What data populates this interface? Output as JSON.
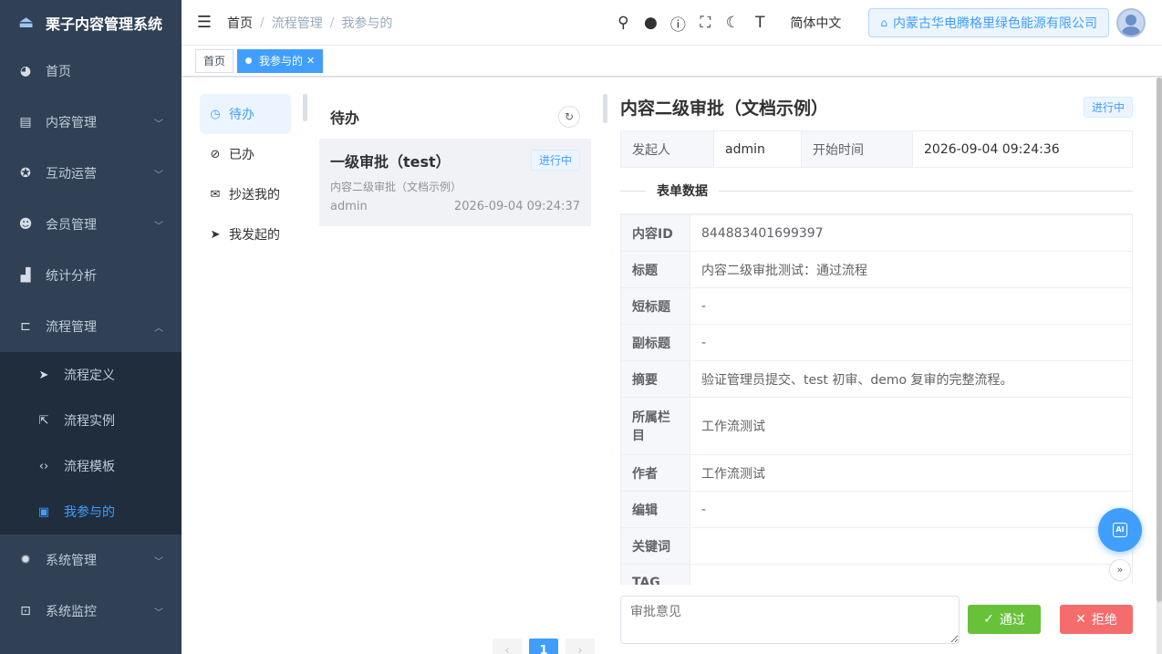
{
  "app": {
    "title": "栗子内容管理系统"
  },
  "sidebar": {
    "items": [
      {
        "label": "首页",
        "icon": "dashboard-icon"
      },
      {
        "label": "内容管理",
        "icon": "document-icon"
      },
      {
        "label": "互动运营",
        "icon": "interaction-icon"
      },
      {
        "label": "会员管理",
        "icon": "users-icon"
      },
      {
        "label": "统计分析",
        "icon": "bar-chart-icon"
      },
      {
        "label": "流程管理",
        "icon": "workflow-icon"
      }
    ],
    "sub_items": [
      {
        "label": "流程定义",
        "icon": "send-icon"
      },
      {
        "label": "流程实例",
        "icon": "instance-icon"
      },
      {
        "label": "流程模板",
        "icon": "code-icon"
      },
      {
        "label": "我参与的",
        "icon": "participate-icon"
      }
    ],
    "bottom_items": [
      {
        "label": "系统管理",
        "icon": "gear-icon"
      },
      {
        "label": "系统监控",
        "icon": "monitor-icon"
      }
    ]
  },
  "header": {
    "breadcrumb": [
      "首页",
      "流程管理",
      "我参与的"
    ],
    "language": "简体中文",
    "org": "内蒙古华电腾格里绿色能源有限公司"
  },
  "tags": {
    "home": "首页",
    "active": "我参与的"
  },
  "leftnav": [
    {
      "label": "待办",
      "icon": "clock-icon"
    },
    {
      "label": "已办",
      "icon": "check-circle-icon"
    },
    {
      "label": "抄送我的",
      "icon": "mail-icon"
    },
    {
      "label": "我发起的",
      "icon": "send-icon"
    }
  ],
  "tasklist": {
    "title": "待办",
    "tasks": [
      {
        "title": "一级审批（test）",
        "status": "进行中",
        "subtitle": "内容二级审批（文档示例）",
        "user": "admin",
        "time": "2026-09-04 09:24:37"
      }
    ],
    "pager": {
      "current": "1"
    }
  },
  "detail": {
    "title": "内容二级审批（文档示例）",
    "status": "进行中",
    "info": {
      "starter_label": "发起人",
      "starter": "admin",
      "start_time_label": "开始时间",
      "start_time": "2026-09-04 09:24:36"
    },
    "form_section": "表单数据",
    "form": [
      {
        "label": "内容ID",
        "value": "844883401699397"
      },
      {
        "label": "标题",
        "value": "内容二级审批测试：通过流程"
      },
      {
        "label": "短标题",
        "value": "-"
      },
      {
        "label": "副标题",
        "value": "-"
      },
      {
        "label": "摘要",
        "value": "验证管理员提交、test 初审、demo 复审的完整流程。"
      },
      {
        "label": "所属栏目",
        "value": "工作流测试"
      },
      {
        "label": "作者",
        "value": "工作流测试"
      },
      {
        "label": "编辑",
        "value": "-"
      },
      {
        "label": "关键词",
        "value": ""
      },
      {
        "label": "TAG",
        "value": ""
      }
    ],
    "comment_placeholder": "审批意见",
    "pass_label": "通过",
    "reject_label": "拒绝"
  },
  "colors": {
    "primary": "#409eff",
    "success": "#67c23a",
    "danger": "#f56c6c",
    "sidebar": "#304156"
  }
}
